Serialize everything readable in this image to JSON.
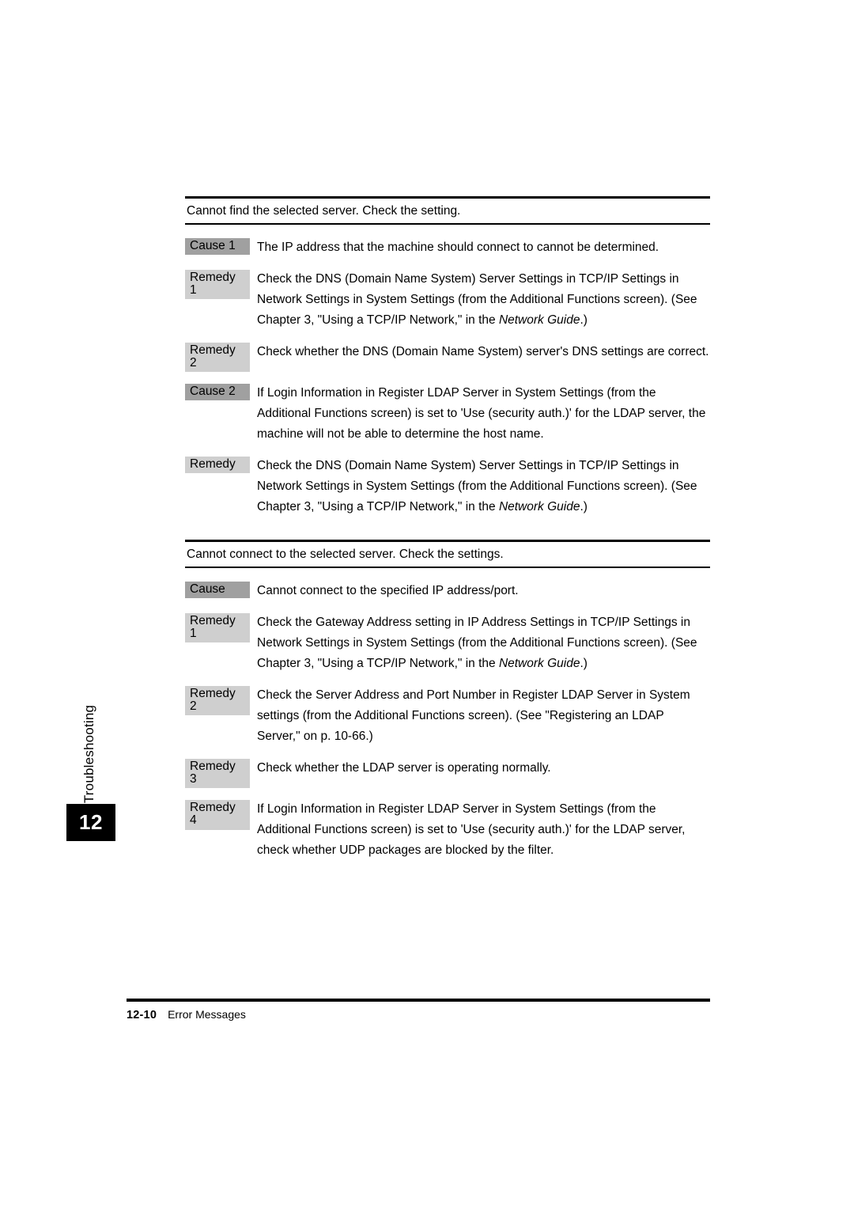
{
  "side_tab": {
    "label": "Troubleshooting",
    "chapter_number": "12"
  },
  "sections": [
    {
      "title": "Cannot find the selected server. Check the setting.",
      "rows": [
        {
          "tag": "Cause 1",
          "kind": "cause",
          "text": "The IP address that the machine should connect to cannot be determined."
        },
        {
          "tag": "Remedy 1",
          "kind": "remedy",
          "text_before": "Check the DNS (Domain Name System) Server Settings in TCP/IP Settings in Network Settings in System Settings (from the Additional Functions screen). (See Chapter 3, \"Using a TCP/IP Network,\" in the ",
          "text_italic": "Network Guide",
          "text_after": ".)"
        },
        {
          "tag": "Remedy 2",
          "kind": "remedy",
          "text": "Check whether the DNS (Domain Name System) server's DNS settings are correct."
        },
        {
          "tag": "Cause 2",
          "kind": "cause",
          "text": "If Login Information in Register LDAP Server in System Settings (from the Additional Functions screen) is set to 'Use (security auth.)' for the LDAP server, the machine will not be able to determine the host name."
        },
        {
          "tag": "Remedy",
          "kind": "remedy",
          "text_before": "Check the DNS (Domain Name System) Server Settings in TCP/IP Settings in Network Settings in System Settings (from the Additional Functions screen). (See Chapter 3, \"Using a TCP/IP Network,\" in the ",
          "text_italic": "Network Guide",
          "text_after": ".)"
        }
      ]
    },
    {
      "title": "Cannot connect to the selected server. Check the settings.",
      "rows": [
        {
          "tag": "Cause",
          "kind": "cause",
          "text": "Cannot connect to the specified IP address/port."
        },
        {
          "tag": "Remedy 1",
          "kind": "remedy",
          "text_before": "Check the Gateway Address setting in IP Address Settings in TCP/IP Settings in Network Settings in System Settings (from the Additional Functions screen). (See Chapter 3, \"Using a TCP/IP Network,\" in the ",
          "text_italic": "Network Guide",
          "text_after": ".)"
        },
        {
          "tag": "Remedy 2",
          "kind": "remedy",
          "text": "Check the Server Address and Port Number in Register LDAP Server in System settings (from the Additional Functions screen). (See \"Registering an LDAP Server,\" on p. 10-66.)"
        },
        {
          "tag": "Remedy 3",
          "kind": "remedy",
          "text": "Check whether the LDAP server is operating normally."
        },
        {
          "tag": "Remedy 4",
          "kind": "remedy",
          "text": "If Login Information in Register LDAP Server in System Settings (from the Additional Functions screen) is set to 'Use (security auth.)' for the LDAP server, check whether UDP packages are blocked by the filter."
        }
      ]
    }
  ],
  "footer": {
    "page_number": "12-10",
    "section_title": "Error Messages"
  },
  "colors": {
    "cause_tag_bg": "#a0a0a0",
    "remedy_tag_bg": "#cfcfcf",
    "chapter_box_bg": "#000000",
    "rule": "#000000"
  }
}
